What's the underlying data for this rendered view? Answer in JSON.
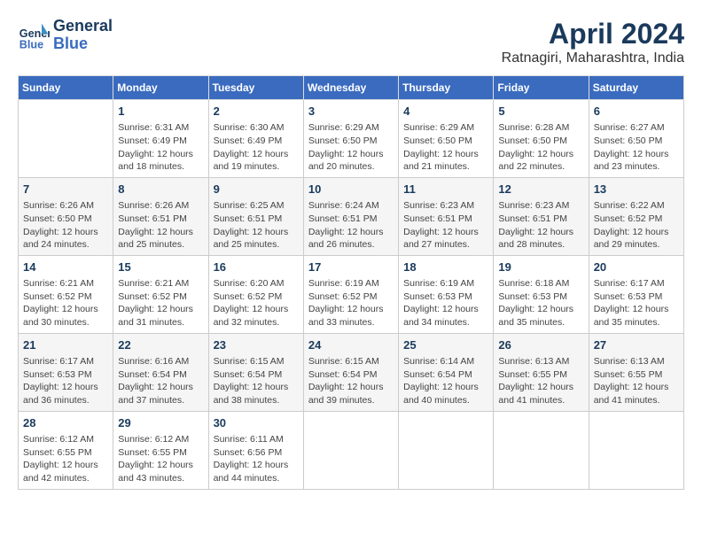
{
  "logo": {
    "line1": "General",
    "line2": "Blue"
  },
  "title": "April 2024",
  "subtitle": "Ratnagiri, Maharashtra, India",
  "headers": [
    "Sunday",
    "Monday",
    "Tuesday",
    "Wednesday",
    "Thursday",
    "Friday",
    "Saturday"
  ],
  "weeks": [
    [
      {
        "day": "",
        "info": ""
      },
      {
        "day": "1",
        "info": "Sunrise: 6:31 AM\nSunset: 6:49 PM\nDaylight: 12 hours\nand 18 minutes."
      },
      {
        "day": "2",
        "info": "Sunrise: 6:30 AM\nSunset: 6:49 PM\nDaylight: 12 hours\nand 19 minutes."
      },
      {
        "day": "3",
        "info": "Sunrise: 6:29 AM\nSunset: 6:50 PM\nDaylight: 12 hours\nand 20 minutes."
      },
      {
        "day": "4",
        "info": "Sunrise: 6:29 AM\nSunset: 6:50 PM\nDaylight: 12 hours\nand 21 minutes."
      },
      {
        "day": "5",
        "info": "Sunrise: 6:28 AM\nSunset: 6:50 PM\nDaylight: 12 hours\nand 22 minutes."
      },
      {
        "day": "6",
        "info": "Sunrise: 6:27 AM\nSunset: 6:50 PM\nDaylight: 12 hours\nand 23 minutes."
      }
    ],
    [
      {
        "day": "7",
        "info": "Sunrise: 6:26 AM\nSunset: 6:50 PM\nDaylight: 12 hours\nand 24 minutes."
      },
      {
        "day": "8",
        "info": "Sunrise: 6:26 AM\nSunset: 6:51 PM\nDaylight: 12 hours\nand 25 minutes."
      },
      {
        "day": "9",
        "info": "Sunrise: 6:25 AM\nSunset: 6:51 PM\nDaylight: 12 hours\nand 25 minutes."
      },
      {
        "day": "10",
        "info": "Sunrise: 6:24 AM\nSunset: 6:51 PM\nDaylight: 12 hours\nand 26 minutes."
      },
      {
        "day": "11",
        "info": "Sunrise: 6:23 AM\nSunset: 6:51 PM\nDaylight: 12 hours\nand 27 minutes."
      },
      {
        "day": "12",
        "info": "Sunrise: 6:23 AM\nSunset: 6:51 PM\nDaylight: 12 hours\nand 28 minutes."
      },
      {
        "day": "13",
        "info": "Sunrise: 6:22 AM\nSunset: 6:52 PM\nDaylight: 12 hours\nand 29 minutes."
      }
    ],
    [
      {
        "day": "14",
        "info": "Sunrise: 6:21 AM\nSunset: 6:52 PM\nDaylight: 12 hours\nand 30 minutes."
      },
      {
        "day": "15",
        "info": "Sunrise: 6:21 AM\nSunset: 6:52 PM\nDaylight: 12 hours\nand 31 minutes."
      },
      {
        "day": "16",
        "info": "Sunrise: 6:20 AM\nSunset: 6:52 PM\nDaylight: 12 hours\nand 32 minutes."
      },
      {
        "day": "17",
        "info": "Sunrise: 6:19 AM\nSunset: 6:52 PM\nDaylight: 12 hours\nand 33 minutes."
      },
      {
        "day": "18",
        "info": "Sunrise: 6:19 AM\nSunset: 6:53 PM\nDaylight: 12 hours\nand 34 minutes."
      },
      {
        "day": "19",
        "info": "Sunrise: 6:18 AM\nSunset: 6:53 PM\nDaylight: 12 hours\nand 35 minutes."
      },
      {
        "day": "20",
        "info": "Sunrise: 6:17 AM\nSunset: 6:53 PM\nDaylight: 12 hours\nand 35 minutes."
      }
    ],
    [
      {
        "day": "21",
        "info": "Sunrise: 6:17 AM\nSunset: 6:53 PM\nDaylight: 12 hours\nand 36 minutes."
      },
      {
        "day": "22",
        "info": "Sunrise: 6:16 AM\nSunset: 6:54 PM\nDaylight: 12 hours\nand 37 minutes."
      },
      {
        "day": "23",
        "info": "Sunrise: 6:15 AM\nSunset: 6:54 PM\nDaylight: 12 hours\nand 38 minutes."
      },
      {
        "day": "24",
        "info": "Sunrise: 6:15 AM\nSunset: 6:54 PM\nDaylight: 12 hours\nand 39 minutes."
      },
      {
        "day": "25",
        "info": "Sunrise: 6:14 AM\nSunset: 6:54 PM\nDaylight: 12 hours\nand 40 minutes."
      },
      {
        "day": "26",
        "info": "Sunrise: 6:13 AM\nSunset: 6:55 PM\nDaylight: 12 hours\nand 41 minutes."
      },
      {
        "day": "27",
        "info": "Sunrise: 6:13 AM\nSunset: 6:55 PM\nDaylight: 12 hours\nand 41 minutes."
      }
    ],
    [
      {
        "day": "28",
        "info": "Sunrise: 6:12 AM\nSunset: 6:55 PM\nDaylight: 12 hours\nand 42 minutes."
      },
      {
        "day": "29",
        "info": "Sunrise: 6:12 AM\nSunset: 6:55 PM\nDaylight: 12 hours\nand 43 minutes."
      },
      {
        "day": "30",
        "info": "Sunrise: 6:11 AM\nSunset: 6:56 PM\nDaylight: 12 hours\nand 44 minutes."
      },
      {
        "day": "",
        "info": ""
      },
      {
        "day": "",
        "info": ""
      },
      {
        "day": "",
        "info": ""
      },
      {
        "day": "",
        "info": ""
      }
    ]
  ]
}
